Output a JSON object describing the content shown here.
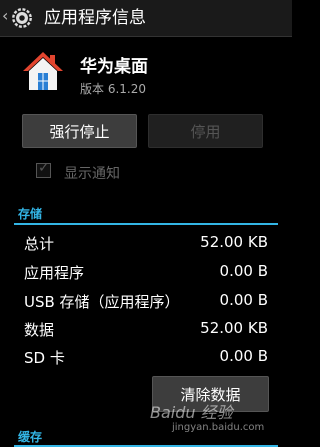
{
  "header": {
    "title": "应用程序信息"
  },
  "app": {
    "name": "华为桌面",
    "version": "版本 6.1.20"
  },
  "buttons": {
    "force_stop": "强行停止",
    "disable": "停用",
    "clear_data": "清除数据"
  },
  "notification": {
    "label": "显示通知",
    "checked": true
  },
  "storage": {
    "header": "存储",
    "rows": [
      {
        "label": "总计",
        "value": "52.00 KB"
      },
      {
        "label": "应用程序",
        "value": "0.00 B"
      },
      {
        "label": "USB 存储（应用程序）",
        "value": "0.00 B"
      },
      {
        "label": "数据",
        "value": "52.00 KB"
      },
      {
        "label": "SD 卡",
        "value": "0.00 B"
      }
    ]
  },
  "cache": {
    "header": "缓存"
  },
  "watermark": {
    "text": "Baidu 经验",
    "url": "jingyan.baidu.com"
  },
  "colors": {
    "accent": "#33b5e5",
    "background": "#000000"
  },
  "icons": {
    "settings": "settings-gear-icon",
    "app": "house-icon",
    "back": "chevron-left-icon"
  }
}
